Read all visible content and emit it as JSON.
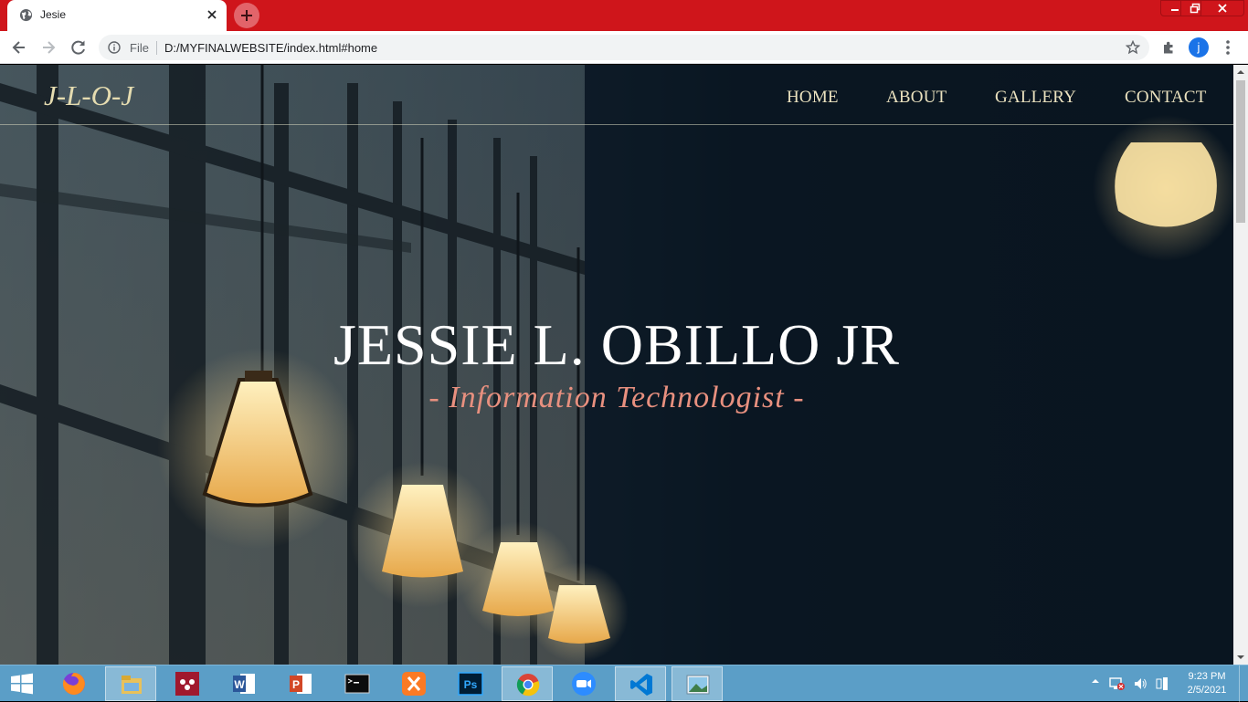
{
  "browser": {
    "tab_title": "Jesie",
    "omnibox_scheme_label": "File",
    "url": "D:/MYFINALWEBSITE/index.html#home",
    "profile_initial": "j",
    "accent_color": "#cf151b"
  },
  "site": {
    "logo": "J-L-O-J",
    "nav": [
      {
        "label": "HOME"
      },
      {
        "label": "ABOUT"
      },
      {
        "label": "GALLERY"
      },
      {
        "label": "CONTACT"
      }
    ],
    "hero_title": "JESSIE L. OBILLO JR",
    "hero_subtitle": "- Information Technologist -",
    "colors": {
      "logo": "#e5dcb0",
      "subtitle": "#e8907f"
    }
  },
  "taskbar": {
    "apps": [
      {
        "icon": "firefox-icon"
      },
      {
        "icon": "file-explorer-icon",
        "active": true
      },
      {
        "icon": "mendeley-icon"
      },
      {
        "icon": "word-icon"
      },
      {
        "icon": "powerpoint-icon"
      },
      {
        "icon": "command-prompt-icon"
      },
      {
        "icon": "xampp-icon"
      },
      {
        "icon": "photoshop-icon"
      },
      {
        "icon": "chrome-icon",
        "active": true
      },
      {
        "icon": "zoom-icon"
      },
      {
        "icon": "vscode-icon",
        "active": true
      },
      {
        "icon": "photos-icon",
        "active": true
      }
    ],
    "clock_time": "9:23 PM",
    "clock_date": "2/5/2021"
  }
}
